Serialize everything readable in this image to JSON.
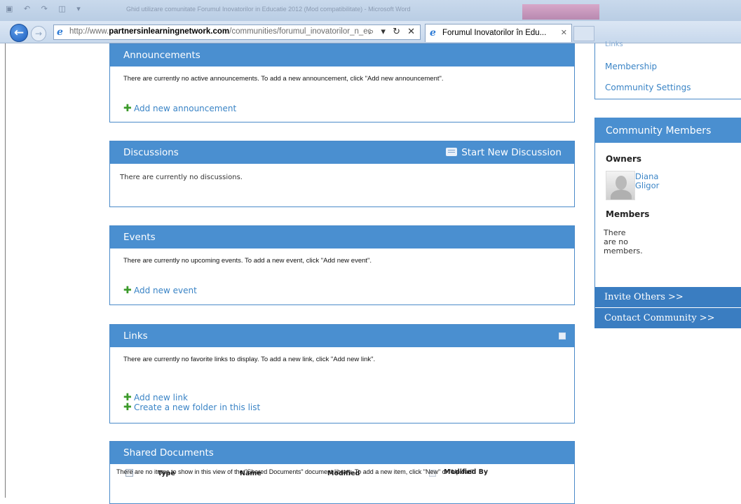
{
  "browser": {
    "window_title": "Ghid utilizare comunitate Forumul Inovatorilor in Educatie 2012 (Mod compatibilitate) - Microsoft Word",
    "url_plain_prefix": "http://www.",
    "url_domain": "partnersinlearningnetwork.com",
    "url_path": "/communities/forumul_inovatorilor_n_educa",
    "address_icons": "⌕ ▾ ↻ ✕",
    "tab_title": "Forumul Inovatorilor în Edu...",
    "tab_close": "✕",
    "back_glyph": "←",
    "forward_glyph": "→"
  },
  "announcements": {
    "title": "Announcements",
    "message": "There are currently no active announcements. To add a new announcement, click \"Add new announcement\".",
    "add_link": "Add new announcement"
  },
  "discussions": {
    "title": "Discussions",
    "start_button": "Start New Discussion",
    "message": "There are currently no discussions."
  },
  "events": {
    "title": "Events",
    "message": "There are currently no upcoming events. To add a new event, click \"Add new event\".",
    "add_link": "Add new event"
  },
  "links": {
    "title": "Links",
    "message": "There are currently no favorite links to display. To add a new link, click \"Add new link\".",
    "add_link": "Add new link",
    "folder_link": "Create a new folder in this list"
  },
  "shared_documents": {
    "title": "Shared Documents",
    "columns": [
      "Type",
      "Name",
      "Modified",
      "Modified By"
    ],
    "message": "There are no items to show in this view of the \"Shared Documents\" document library. To add a new item, click \"New\" or \"Upload\"."
  },
  "sidebar": {
    "links": [
      "Links",
      "Membership",
      "Community Settings"
    ],
    "members_title": "Community Members",
    "owners_label": "Owners",
    "owner_name": "Diana Gligor",
    "members_label": "Members",
    "no_members": "There are no members.",
    "invite_button": "Invite Others >>",
    "contact_button": "Contact Community >>"
  },
  "icons": {
    "add": "plus-icon",
    "discussion": "chat-icon",
    "browser": "ie-icon",
    "avatar": "default-avatar-icon"
  },
  "colors": {
    "panel_header": "#4a8fd0",
    "link": "#3a84c6",
    "add_icon": "#3b9a2a",
    "sidebar_button": "#3a7dc1"
  }
}
